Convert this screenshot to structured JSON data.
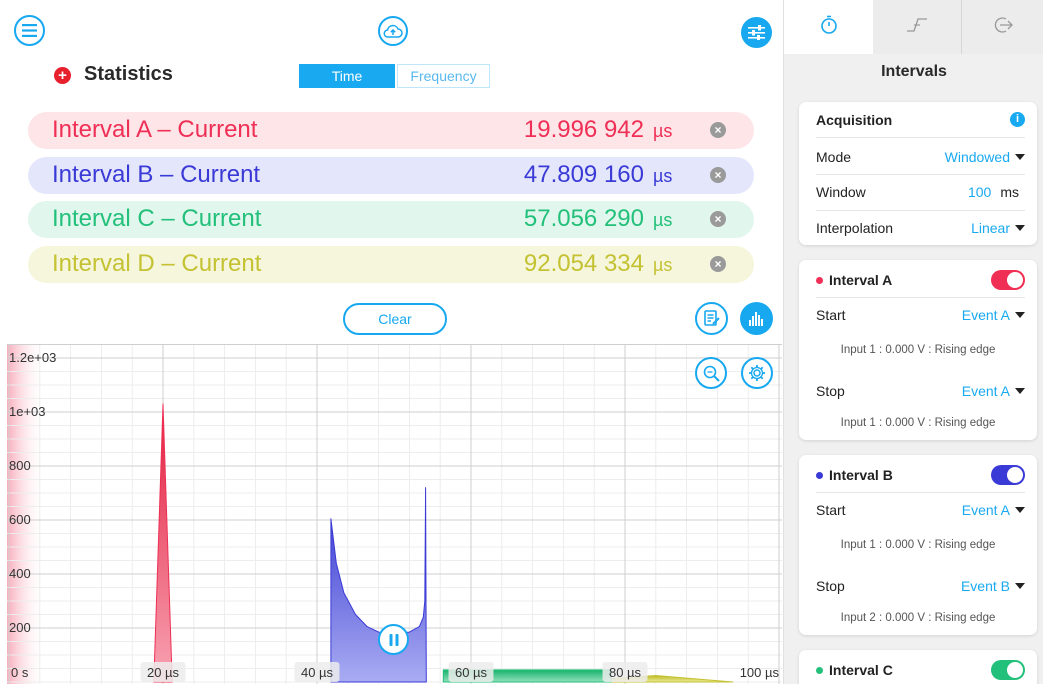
{
  "toolbar": {
    "menu_icon": "hamburger-menu-icon",
    "cloud_icon": "cloud-upload-icon",
    "settings_icon": "sliders-icon"
  },
  "statistics": {
    "title": "Statistics",
    "toggle_icon": "plus-circle-icon",
    "tabs": [
      {
        "label": "Time",
        "active": true
      },
      {
        "label": "Frequency",
        "active": false
      }
    ]
  },
  "intervals": [
    {
      "label": "Interval A – Current",
      "value": "19.996 942",
      "unit": "µs",
      "color": "#ef2f55",
      "bg": "#fde5e8"
    },
    {
      "label": "Interval B – Current",
      "value": "47.809 160",
      "unit": "µs",
      "color": "#3a3ad6",
      "bg": "#e4e6fb"
    },
    {
      "label": "Interval C – Current",
      "value": "57.056 290",
      "unit": "µs",
      "color": "#22c07a",
      "bg": "#e1f6ec"
    },
    {
      "label": "Interval D – Current",
      "value": "92.054 334",
      "unit": "µs",
      "color": "#c4c232",
      "bg": "#f5f6dc"
    }
  ],
  "clear_label": "Clear",
  "chart_data": {
    "type": "area",
    "x_unit": "µs",
    "xlim": [
      0,
      100
    ],
    "ylim": [
      0,
      1200
    ],
    "x_ticks": [
      "0 s",
      "20 µs",
      "40 µs",
      "60 µs",
      "80 µs",
      "100 µs"
    ],
    "y_ticks": [
      "200",
      "400",
      "600",
      "800",
      "1e+03",
      "1.2e+03"
    ],
    "y_tick_values": [
      200,
      400,
      600,
      800,
      1000,
      1200
    ],
    "grid": true,
    "series": [
      {
        "color": "#ef2f55",
        "points": [
          [
            18.8,
            0
          ],
          [
            20.0,
            1030
          ],
          [
            21.2,
            0
          ]
        ]
      },
      {
        "color": "#3a3ad6",
        "points": [
          [
            41.8,
            0
          ],
          [
            41.8,
            605
          ],
          [
            42.5,
            440
          ],
          [
            43.5,
            330
          ],
          [
            45,
            250
          ],
          [
            46.5,
            205
          ],
          [
            48,
            185
          ],
          [
            50,
            180
          ],
          [
            52,
            185
          ],
          [
            53.3,
            205
          ],
          [
            53.8,
            240
          ],
          [
            54.0,
            300
          ],
          [
            54.1,
            720
          ],
          [
            54.2,
            0
          ]
        ]
      },
      {
        "color": "#22c07a",
        "points": [
          [
            56.4,
            0
          ],
          [
            56.4,
            45
          ],
          [
            78.2,
            45
          ],
          [
            78.2,
            0
          ]
        ]
      },
      {
        "color": "#c4c232",
        "points": [
          [
            71.5,
            0
          ],
          [
            78,
            12
          ],
          [
            84,
            24
          ],
          [
            89,
            12
          ],
          [
            94,
            0
          ]
        ]
      }
    ]
  },
  "chart_controls": {
    "report_icon": "edit-report-icon",
    "histogram_icon": "histogram-icon",
    "zoom_icon": "zoom-fit-icon",
    "gear_icon": "gear-icon",
    "pause_icon": "pause-icon"
  },
  "panel": {
    "tabs": [
      {
        "icon": "stopwatch-icon",
        "active": true
      },
      {
        "icon": "edge-icon",
        "active": false
      },
      {
        "icon": "output-icon",
        "active": false
      }
    ],
    "title": "Intervals",
    "acquisition": {
      "header": "Acquisition",
      "info_icon": "info-icon",
      "mode_label": "Mode",
      "mode_value": "Windowed",
      "window_label": "Window",
      "window_value": "100",
      "window_unit": "ms",
      "interp_label": "Interpolation",
      "interp_value": "Linear"
    },
    "interval_cards": [
      {
        "name": "Interval A",
        "color": "#ef2f55",
        "enabled": true,
        "start_label": "Start",
        "start_value": "Event A",
        "start_desc": "Input 1 : 0.000 V : Rising edge",
        "stop_label": "Stop",
        "stop_value": "Event A",
        "stop_desc": "Input 1 : 0.000 V : Rising edge"
      },
      {
        "name": "Interval B",
        "color": "#3a3ad6",
        "enabled": true,
        "start_label": "Start",
        "start_value": "Event A",
        "start_desc": "Input 1 : 0.000 V : Rising edge",
        "stop_label": "Stop",
        "stop_value": "Event B",
        "stop_desc": "Input 2 : 0.000 V : Rising edge"
      },
      {
        "name": "Interval C",
        "color": "#22c07a",
        "enabled": true
      }
    ]
  }
}
